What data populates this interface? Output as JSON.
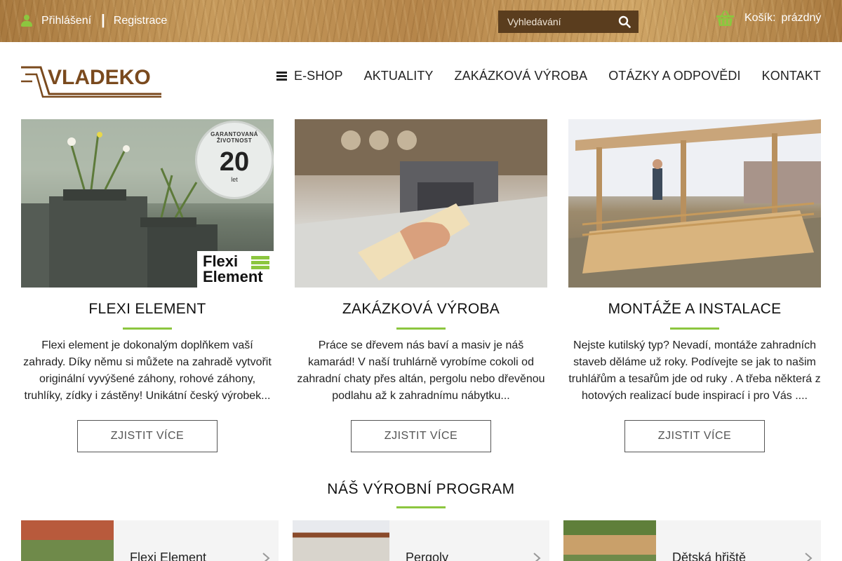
{
  "topbar": {
    "login_label": "Přihlášení",
    "separator": "|",
    "register_label": "Registrace",
    "search_placeholder": "Vyhledávání",
    "cart_label": "Košík:",
    "cart_state": "prázdný"
  },
  "header": {
    "logo_text": "VLADEKO",
    "nav": [
      {
        "label": "E-SHOP"
      },
      {
        "label": "AKTUALITY"
      },
      {
        "label": "ZAKÁZKOVÁ VÝROBA"
      },
      {
        "label": "OTÁZKY A ODPOVĚDI"
      },
      {
        "label": "KONTAKT"
      }
    ]
  },
  "cards": [
    {
      "title": "FLEXI ELEMENT",
      "text": "Flexi element je dokonalým doplňkem vaší zahrady. Díky němu si můžete na zahradě vytvořit originální vyvýšené záhony, rohové záhony, truhlíky, zídky i zástěny! Unikátní český výrobek...",
      "button": "ZJISTIT VÍCE",
      "badge_top": "GARANTOVANÁ ŽIVOTNOST",
      "badge_number": "20",
      "badge_unit": "let",
      "brand_line1": "Flexi",
      "brand_line2": "Element"
    },
    {
      "title": "ZAKÁZKOVÁ VÝROBA",
      "text": "Práce se dřevem nás baví a masiv je náš kamarád! V naší truhlárně vyrobíme cokoli od zahradní chaty přes altán, pergolu nebo dřevěnou podlahu až k zahradnímu nábytku...",
      "button": "ZJISTIT VÍCE"
    },
    {
      "title": "MONTÁŽE A INSTALACE",
      "text": "Nejste kutilský typ? Nevadí, montáže zahradních staveb děláme už roky. Podívejte se jak to našim truhlářům a tesařům jde od ruky . A třeba některá z hotových realizací bude inspirací i pro Vás ....",
      "button": "ZJISTIT VÍCE"
    }
  ],
  "program": {
    "title": "NÁŠ VÝROBNÍ PROGRAM",
    "items": [
      {
        "label": "Flexi Element"
      },
      {
        "label": "Pergoly"
      },
      {
        "label": "Dětská hřiště"
      }
    ]
  },
  "colors": {
    "accent": "#8cc63f",
    "logo_brown": "#7a4a1e",
    "search_bg": "#5a3d1e"
  }
}
